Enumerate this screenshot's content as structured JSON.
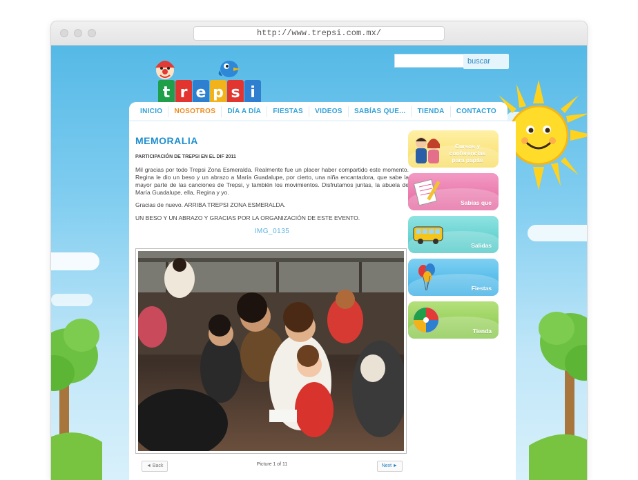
{
  "browser": {
    "url": "http://www.trepsi.com.mx/"
  },
  "logo": {
    "letters": [
      "t",
      "r",
      "e",
      "p",
      "s",
      "i"
    ]
  },
  "search": {
    "placeholder": "",
    "button_label": "buscar"
  },
  "nav": {
    "items": [
      {
        "label": "INICIO",
        "active": false
      },
      {
        "label": "NOSOTROS",
        "active": true
      },
      {
        "label": "DÍA A DÍA",
        "active": false
      },
      {
        "label": "FIESTAS",
        "active": false
      },
      {
        "label": "VIDEOS",
        "active": false
      },
      {
        "label": "SABÍAS QUE...",
        "active": false
      },
      {
        "label": "TIENDA",
        "active": false
      },
      {
        "label": "CONTACTO",
        "active": false
      }
    ],
    "active_color": "#f08a1c",
    "color": "#2fa0d8"
  },
  "main": {
    "title": "MEMORALIA",
    "subtitle": "PARTICIPACIÓN DE TREPSI EN EL DIF 2011",
    "paragraph1": "Mil gracias por todo Trepsi Zona Esmeralda.  Realmente fue un placer haber compartido este momento. Regina le dio un beso y un abrazo a María Guadalupe, por cierto, una niña encantadora, que sabe la mayor parte de las canciones de Trepsi, y también los movimientos. Disfrutamos juntas, la abuela de María Guadalupe, ella, Regina y yo.",
    "paragraph2": "Gracias de nuevo. ARRIBA TREPSI ZONA ESMERALDA.",
    "paragraph3": "UN BESO Y UN ABRAZO Y GRACIAS POR LA ORGANIZACIÓN DE ESTE EVENTO.",
    "image_caption": "IMG_0135"
  },
  "pager": {
    "back_label": "◄ Back",
    "info": "Picture 1 of 11",
    "next_label": "Next ►"
  },
  "sidebar": {
    "cards": [
      {
        "label": "Cursos y conferencias para papás",
        "icon": "parents-icon"
      },
      {
        "label": "Sabías que",
        "icon": "notepad-icon"
      },
      {
        "label": "Salidas",
        "icon": "bus-icon"
      },
      {
        "label": "Fiestas",
        "icon": "balloons-icon"
      },
      {
        "label": "Tienda",
        "icon": "beach-ball-icon"
      }
    ]
  }
}
